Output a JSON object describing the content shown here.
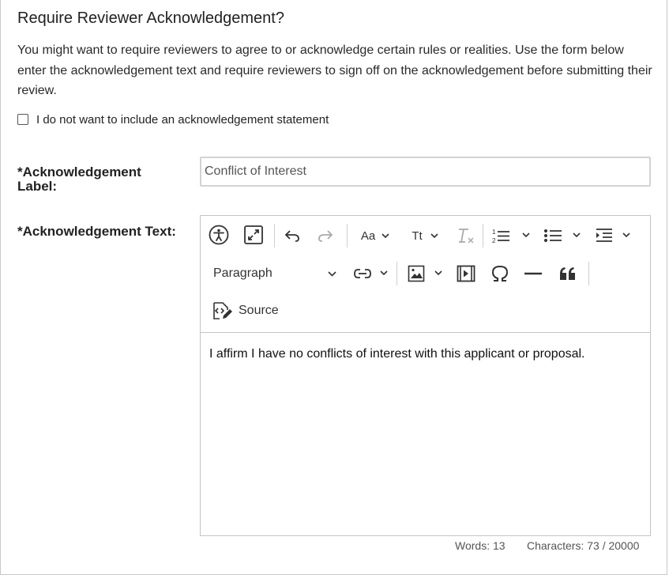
{
  "section": {
    "title": "Require Reviewer Acknowledgement?",
    "description": "You might want to require reviewers to agree to or acknowledge certain rules or realities. Use the form below enter the acknowledgement text and require reviewers to sign off on the acknowledgement before submitting their review.",
    "optout_label": "I do not want to include an acknowledgement statement",
    "optout_checked": false
  },
  "form": {
    "label_field_label_line1": "*Acknowledgement",
    "label_field_label_line2": "Label:",
    "label_value": "Conflict of Interest",
    "text_field_label": "*Acknowledgement Text:"
  },
  "editor": {
    "toolbar": {
      "accessibility_icon": "accessibility-icon",
      "fullscreen_icon": "maximize-icon",
      "undo_icon": "undo-icon",
      "redo_icon": "redo-icon",
      "font_family_label": "Aa",
      "font_size_label": "Tt",
      "remove_format_icon": "remove-format-icon",
      "numbered_list_icon": "numbered-list-icon",
      "bulleted_list_icon": "bulleted-list-icon",
      "indent_icon": "indent-icon",
      "heading_selected": "Paragraph",
      "link_icon": "link-icon",
      "image_icon": "image-icon",
      "media_icon": "media-icon",
      "special_char_icon": "omega-icon",
      "horizontal_line_icon": "horizontal-line-icon",
      "blockquote_icon": "quote-icon",
      "source_label": "Source"
    },
    "content": "I affirm I have no conflicts of interest with this applicant or proposal.",
    "words_text": "Words: 13",
    "characters_text": "Characters: 73 / 20000"
  }
}
